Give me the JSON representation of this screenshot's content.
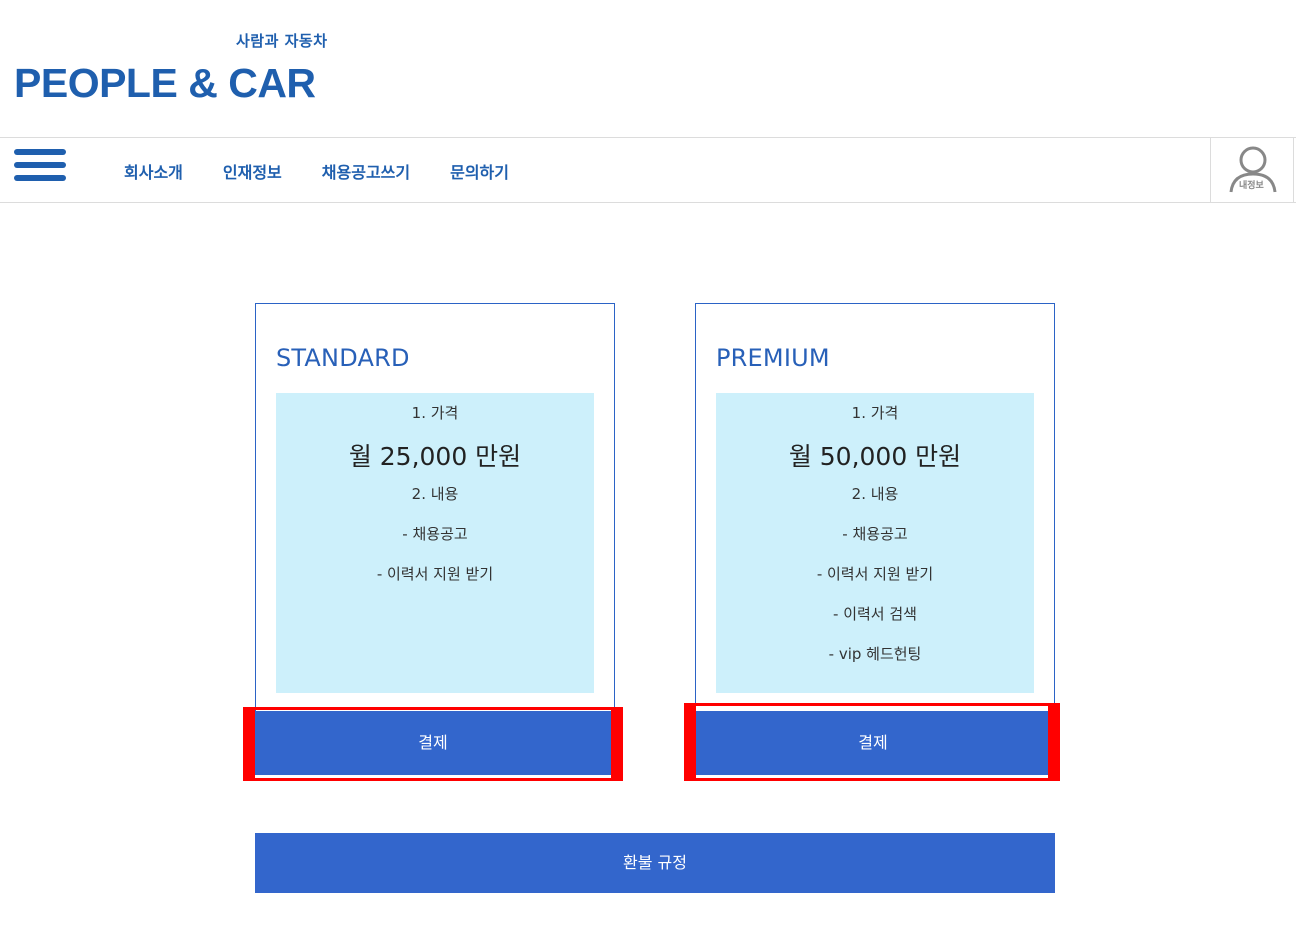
{
  "logo": {
    "subtitle": "사람과 자동차",
    "title": "PEOPLE & CAR"
  },
  "nav": {
    "menu_icon": "hamburger-menu-icon",
    "items": [
      "회사소개",
      "인재정보",
      "채용공고쓰기",
      "문의하기"
    ],
    "my_info_label": "내정보",
    "my_info_icon": "user-icon"
  },
  "plans": [
    {
      "name": "STANDARD",
      "price_heading": "1. 가격",
      "price": "월 25,000 만원",
      "content_heading": "2. 내용",
      "features": [
        "- 채용공고",
        "- 이력서 지원 받기"
      ],
      "button": "결제"
    },
    {
      "name": "PREMIUM",
      "price_heading": "1. 가격",
      "price": "월 50,000 만원",
      "content_heading": "2. 내용",
      "features": [
        "- 채용공고",
        "- 이력서 지원 받기",
        "- 이력서 검색",
        "- vip 헤드헌팅"
      ],
      "button": "결제"
    }
  ],
  "refund_button": "환불 규정",
  "colors": {
    "brand": "#1f5fae",
    "button": "#3366cc",
    "card_body": "#cdf0fb",
    "highlight": "#ff0000"
  }
}
